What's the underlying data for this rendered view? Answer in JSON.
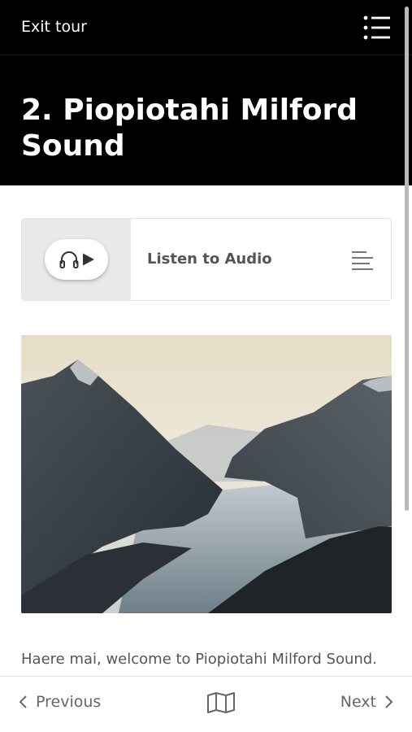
{
  "header": {
    "exit_label": "Exit tour",
    "menu_icon": "list-menu-icon"
  },
  "stop": {
    "title": "2. Piopiotahi Milford Sound"
  },
  "audio": {
    "label": "Listen to Audio",
    "play_icon": "headphones-play-icon",
    "transcript_icon": "transcript-lines-icon"
  },
  "photo": {
    "subject": "Milford Sound fiord mountains at dawn"
  },
  "body": {
    "intro": "Haere mai, welcome to Piopiotahi Milford Sound."
  },
  "footer": {
    "previous_label": "Previous",
    "next_label": "Next",
    "map_icon": "map-icon"
  },
  "colors": {
    "header_bg": "#000000",
    "audio_left_bg": "#e9e9e9",
    "text_muted": "#555555"
  }
}
